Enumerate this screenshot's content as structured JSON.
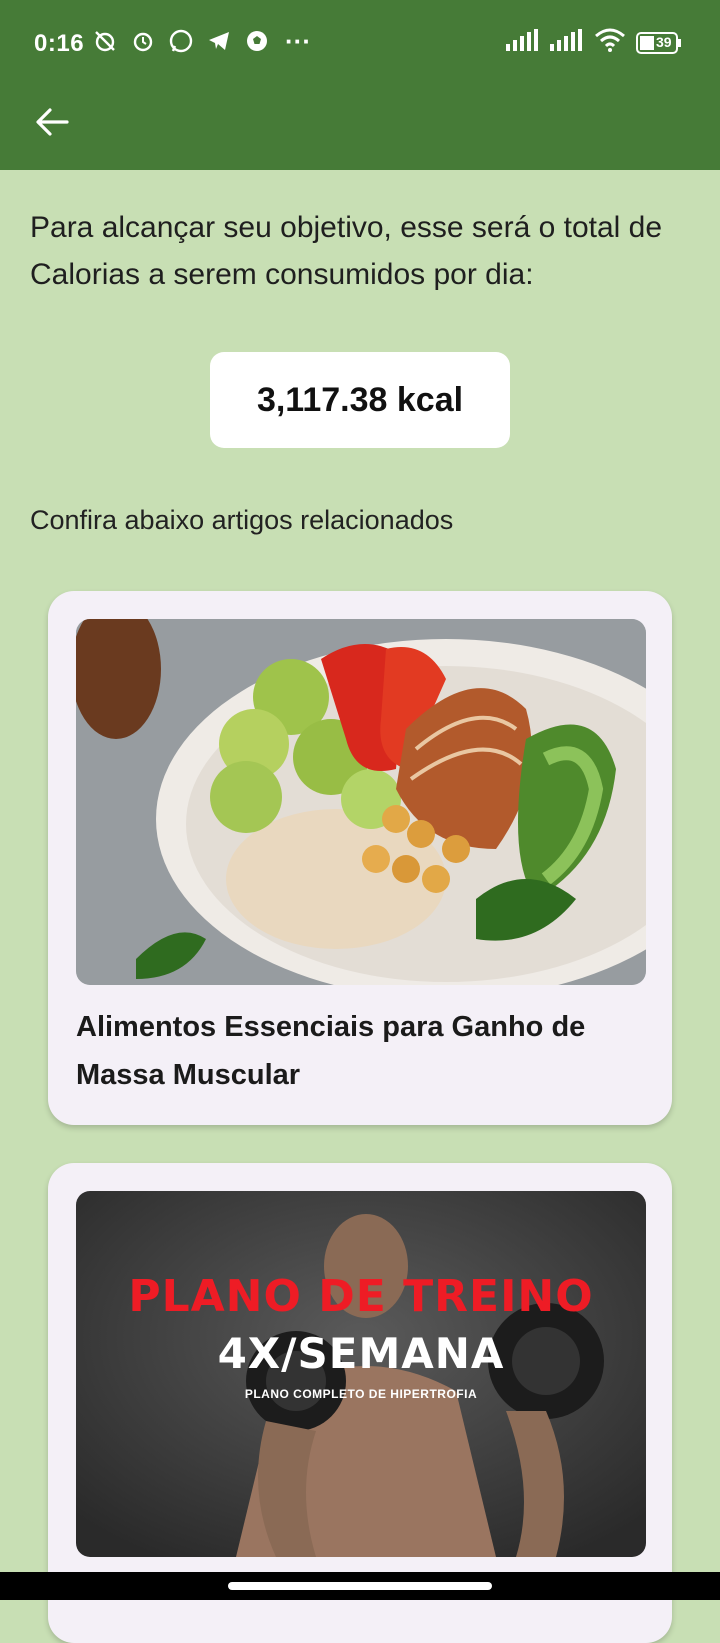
{
  "status_bar": {
    "time": "0:16",
    "dots": "···",
    "battery": "39"
  },
  "header": {
    "back_icon": "arrow-left-icon"
  },
  "colors": {
    "appbar": "#467b37",
    "background": "#c8dfb4",
    "card": "#f4f0f7"
  },
  "main": {
    "intro_text": "Para alcançar seu objetivo, esse será o total de Calorias a serem consumidos por dia:",
    "kcal_value": "3,117.38 kcal",
    "section_label": "Confira abaixo artigos relacionados"
  },
  "articles": [
    {
      "title": "Alimentos Essenciais para Ganho de Massa Muscular"
    },
    {
      "poster_line1": "PLANO DE TREINO",
      "poster_line2": "4X/SEMANA",
      "poster_line3": "PLANO COMPLETO DE HIPERTROFIA"
    }
  ]
}
